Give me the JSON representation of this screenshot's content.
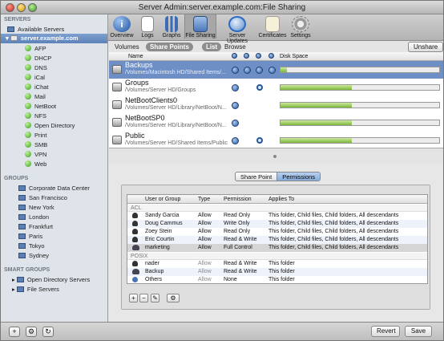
{
  "window": {
    "title": "Server Admin:server.example.com:File Sharing"
  },
  "sidebar": {
    "servers_header": "SERVERS",
    "available_servers": "Available Servers",
    "server": "server.example.com",
    "services": [
      "AFP",
      "DHCP",
      "DNS",
      "iCal",
      "iChat",
      "Mail",
      "NetBoot",
      "NFS",
      "Open Directory",
      "Print",
      "SMB",
      "VPN",
      "Web"
    ],
    "groups_header": "GROUPS",
    "groups": [
      "Corporate Data Center",
      "San Francisco",
      "New York",
      "London",
      "Frankfurt",
      "Paris",
      "Tokyo",
      "Sydney"
    ],
    "smart_groups_header": "SMART GROUPS",
    "smart_groups": [
      "Open Directory Servers",
      "File Servers"
    ]
  },
  "toolbar": {
    "items": [
      "Overview",
      "Logs",
      "Graphs",
      "File Sharing",
      "Server Updates",
      "Certificates",
      "Settings"
    ],
    "active": "File Sharing"
  },
  "subnav": {
    "volumes": "Volumes",
    "share_points": "Share Points",
    "list": "List",
    "browse": "Browse",
    "unshare": "Unshare"
  },
  "columns": {
    "name": "Name",
    "disk_space": "Disk Space"
  },
  "shares": [
    {
      "name": "Backups",
      "path": "/Volumes/Macintosh HD/Shared Items/...",
      "usage": 0.04
    },
    {
      "name": "Groups",
      "path": "/Volumes/Server HD/Groups",
      "usage": 0.45
    },
    {
      "name": "NetBootClients0",
      "path": "/Volumes/Server HD/Library/NetBoot/N...",
      "usage": 0.45
    },
    {
      "name": "NetBootSP0",
      "path": "/Volumes/Server HD/Library/NetBoot/N...",
      "usage": 0.45
    },
    {
      "name": "Public",
      "path": "/Volumes/Server HD/Shared Items/Public",
      "usage": 0.45
    }
  ],
  "tabs": {
    "share_point": "Share Point",
    "permissions": "Permissions"
  },
  "permissions": {
    "headers": {
      "user_or_group": "User or Group",
      "type": "Type",
      "permission": "Permission",
      "applies_to": "Applies To"
    },
    "acl_label": "ACL",
    "acl": [
      {
        "name": "Sandy Garcia",
        "type": "Allow",
        "perm": "Read Only",
        "applies": "This folder, Child files, Child folders, All descendants"
      },
      {
        "name": "Doug Cammus",
        "type": "Allow",
        "perm": "Write Only",
        "applies": "This folder, Child files, Child folders, All descendants"
      },
      {
        "name": "Zoey Stein",
        "type": "Allow",
        "perm": "Read Only",
        "applies": "This folder, Child files, Child folders, All descendants"
      },
      {
        "name": "Eric Courtin",
        "type": "Allow",
        "perm": "Read & Write",
        "applies": "This folder, Child files, Child folders, All descendants"
      },
      {
        "name": "marketing",
        "type": "Allow",
        "perm": "Full Control",
        "applies": "This folder, Child files, Child folders, All descendants"
      }
    ],
    "posix_label": "POSIX",
    "posix": [
      {
        "name": "nader",
        "type": "Allow",
        "perm": "Read & Write",
        "applies": "This folder"
      },
      {
        "name": "Backup",
        "type": "Allow",
        "perm": "Read & Write",
        "applies": "This folder"
      },
      {
        "name": "Others",
        "type": "Allow",
        "perm": "None",
        "applies": "This folder"
      }
    ]
  },
  "footer": {
    "revert": "Revert",
    "save": "Save"
  }
}
